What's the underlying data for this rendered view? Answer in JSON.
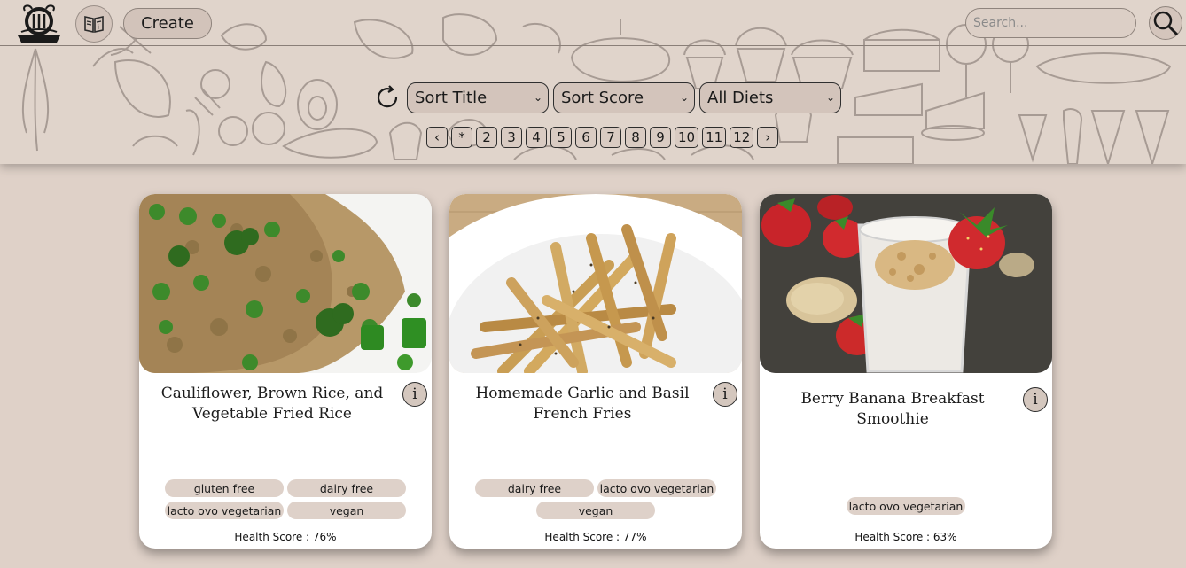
{
  "header": {
    "create_label": "Create",
    "search_placeholder": "Search...",
    "sort_title": "Sort Title",
    "sort_score": "Sort Score",
    "diet_filter": "All Diets",
    "pagination": {
      "prev": "‹",
      "next": "›",
      "pages": [
        "*",
        "2",
        "3",
        "4",
        "5",
        "6",
        "7",
        "8",
        "9",
        "10",
        "11",
        "12"
      ]
    },
    "icons": {
      "logo": "chef-hat-utensils-icon",
      "book": "recipe-book-icon",
      "search": "search-icon",
      "refresh": "refresh-icon"
    }
  },
  "recipes": [
    {
      "title": "Cauliflower, Brown Rice, and Vegetable Fried Rice",
      "info": "i",
      "tags": [
        "gluten free",
        "dairy free",
        "lacto ovo vegetarian",
        "vegan"
      ],
      "health_score": "Health Score : 76%"
    },
    {
      "title": "Homemade Garlic and Basil French Fries",
      "info": "i",
      "tags": [
        "dairy free",
        "lacto ovo vegetarian",
        "vegan"
      ],
      "health_score": "Health Score : 77%"
    },
    {
      "title": "Berry Banana Breakfast Smoothie",
      "info": "i",
      "tags": [
        "lacto ovo vegetarian"
      ],
      "health_score": "Health Score : 63%"
    }
  ],
  "colors": {
    "background": "#dfd1c8",
    "header": "#e0d4cb",
    "tag": "#ded1c9",
    "card": "#ffffff"
  }
}
